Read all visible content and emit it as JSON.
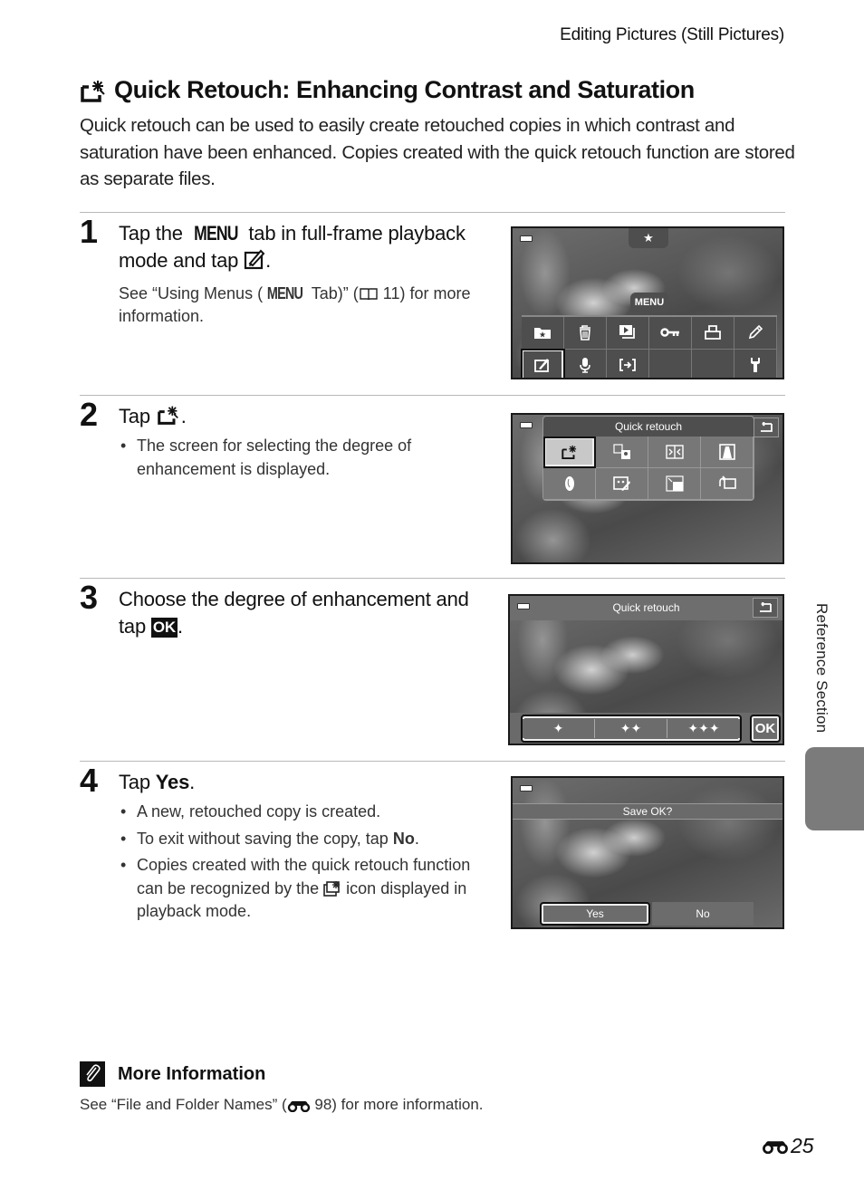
{
  "running_head": "Editing Pictures (Still Pictures)",
  "title": "Quick Retouch: Enhancing Contrast and Saturation",
  "intro": "Quick retouch can be used to easily create retouched copies in which contrast and saturation have been enhanced. Copies created with the quick retouch function are stored as separate files.",
  "steps": [
    {
      "number": "1",
      "heading_pre": "Tap the ",
      "heading_menu": "MENU",
      "heading_mid": " tab in full-frame playback mode and tap ",
      "heading_post": ".",
      "sub_pre": "See “Using Menus (",
      "sub_menu": "MENU",
      "sub_mid": " Tab)” (",
      "sub_ref": " 11) for more information."
    },
    {
      "number": "2",
      "heading_pre": "Tap ",
      "heading_post": ".",
      "bullets": [
        "The screen for selecting the degree of enhancement is displayed."
      ]
    },
    {
      "number": "3",
      "heading_pre": "Choose the degree of enhancement and tap ",
      "heading_ok": "OK",
      "heading_post": "."
    },
    {
      "number": "4",
      "heading_pre": "Tap ",
      "heading_bold": "Yes",
      "heading_post": ".",
      "bullets": [
        "A new, retouched copy is created.",
        "To exit without saving the copy, tap ",
        "Copies created with the quick retouch function can be recognized by the ",
        "displayed in playback mode."
      ],
      "bullet2_bold": "No",
      "bullet2_post": ".",
      "bullet3_post": " icon"
    }
  ],
  "screens": {
    "s1": {
      "star_tab": "★",
      "menu_tab": "MENU",
      "icons": [
        "favorite-folder",
        "delete",
        "slide-show",
        "protect",
        "print-order",
        "edit",
        "retouch",
        "voice-memo",
        "copy",
        "",
        "",
        "setup"
      ]
    },
    "s2": {
      "title": "Quick retouch",
      "icons": [
        "quick-retouch",
        "d-lighting",
        "skin-softening",
        "filter-effects",
        "glamour",
        "paint",
        "small-picture",
        "crop"
      ]
    },
    "s3": {
      "title": "Quick retouch",
      "levels": [
        "✦",
        "✦✦",
        "✦✦✦"
      ],
      "ok": "OK"
    },
    "s4": {
      "prompt": "Save OK?",
      "yes": "Yes",
      "no": "No"
    }
  },
  "side_label": "Reference Section",
  "more_info": {
    "heading": "More Information",
    "text_pre": "See “File and Folder Names” (",
    "text_post": " 98) for more information."
  },
  "page_number": "25"
}
